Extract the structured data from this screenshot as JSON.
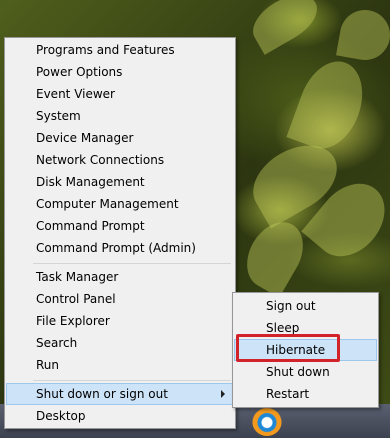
{
  "context_menu": {
    "items": [
      {
        "label": "Programs and Features"
      },
      {
        "label": "Power Options"
      },
      {
        "label": "Event Viewer"
      },
      {
        "label": "System"
      },
      {
        "label": "Device Manager"
      },
      {
        "label": "Network Connections"
      },
      {
        "label": "Disk Management"
      },
      {
        "label": "Computer Management"
      },
      {
        "label": "Command Prompt"
      },
      {
        "label": "Command Prompt (Admin)"
      },
      {
        "label": "Task Manager"
      },
      {
        "label": "Control Panel"
      },
      {
        "label": "File Explorer"
      },
      {
        "label": "Search"
      },
      {
        "label": "Run"
      },
      {
        "label": "Shut down or sign out"
      },
      {
        "label": "Desktop"
      }
    ]
  },
  "shutdown_submenu": {
    "items": [
      {
        "label": "Sign out"
      },
      {
        "label": "Sleep"
      },
      {
        "label": "Hibernate"
      },
      {
        "label": "Shut down"
      },
      {
        "label": "Restart"
      }
    ],
    "highlight_color": "#d2232a"
  },
  "colors": {
    "menu_background": "#f0f0f0",
    "hover_background": "#cde3f7",
    "callout_red": "#d2232a"
  }
}
